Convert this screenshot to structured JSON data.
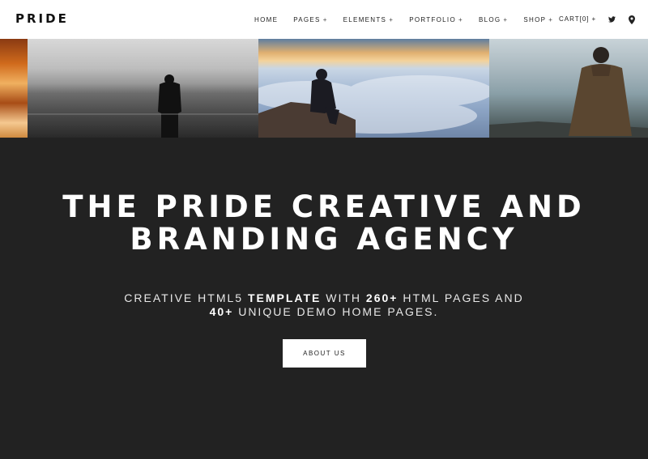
{
  "header": {
    "logo": "PRIDE",
    "nav": [
      {
        "label": "HOME",
        "dropdown": false
      },
      {
        "label": "PAGES",
        "dropdown": true
      },
      {
        "label": "ELEMENTS",
        "dropdown": true
      },
      {
        "label": "PORTFOLIO",
        "dropdown": true
      },
      {
        "label": "BLOG",
        "dropdown": true
      },
      {
        "label": "SHOP",
        "dropdown": true
      }
    ],
    "cart_label": "CART[0]",
    "dropdown_marker": "+",
    "icons": [
      "twitter-icon",
      "map-marker-icon"
    ]
  },
  "gallery": {
    "images": [
      "fire-closeup",
      "person-standing-in-sea",
      "person-sitting-above-clouds",
      "person-sitting-on-hill"
    ]
  },
  "hero": {
    "title_line1": "THE PRIDE CREATIVE AND",
    "title_line2": "BRANDING AGENCY",
    "subtitle": {
      "part1": "CREATIVE HTML5 ",
      "bold1": "TEMPLATE",
      "part2": " WITH ",
      "bold2": "260+",
      "part3": " HTML PAGES AND",
      "bold3": "40+",
      "part4": " UNIQUE DEMO HOME PAGES."
    },
    "button_label": "ABOUT US"
  },
  "colors": {
    "header_bg": "#ffffff",
    "hero_bg": "#222222",
    "text_light": "#ffffff",
    "text_dark": "#222222"
  }
}
